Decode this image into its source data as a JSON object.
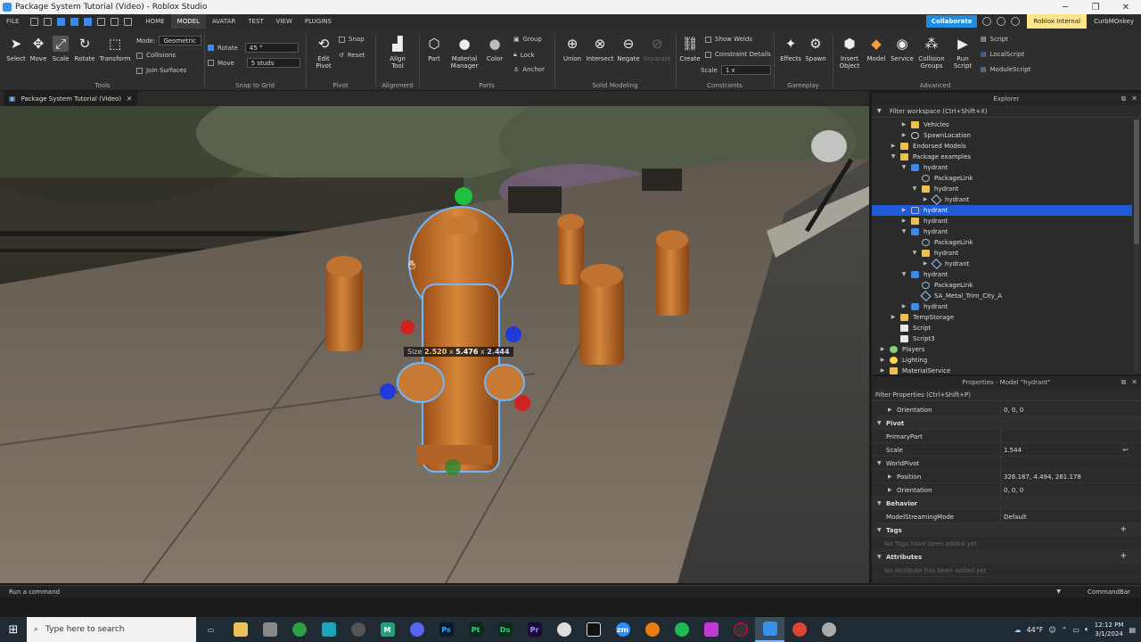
{
  "window": {
    "title": "Package System Tutorial (Video) - Roblox Studio"
  },
  "menu": {
    "items": [
      "FILE",
      "HOME",
      "MODEL",
      "AVATAR",
      "TEST",
      "VIEW",
      "PLUGINS"
    ],
    "active": "MODEL",
    "collaborate": "Collaborate",
    "badge": "Roblox Internal",
    "user": "CurbMOnkey"
  },
  "ribbon": {
    "tools": {
      "select": "Select",
      "move": "Move",
      "scale": "Scale",
      "rotate": "Rotate",
      "transform": "Transform",
      "group": "Tools"
    },
    "mode_label": "Mode:",
    "mode_value": "Geometric",
    "collisions": "Collisions",
    "join_surfaces": "Join Surfaces",
    "snap": {
      "rotate_label": "Rotate",
      "rotate_value": "45 °",
      "move_label": "Move",
      "move_value": "5 studs",
      "group": "Snap to Grid"
    },
    "pivot": {
      "edit": "Edit\nPivot",
      "snap": "Snap",
      "reset": "Reset",
      "group": "Pivot"
    },
    "alignment": {
      "align": "Align\nTool",
      "group": "Alignment"
    },
    "parts": {
      "part": "Part",
      "material": "Material\nManager",
      "color": "Color",
      "group_btn": "Group",
      "lock": "Lock",
      "anchor": "Anchor",
      "group": "Parts"
    },
    "solid": {
      "union": "Union",
      "intersect": "Intersect",
      "negate": "Negate",
      "separate": "Separate",
      "group": "Solid Modeling"
    },
    "constraints": {
      "create": "Create",
      "show_welds": "Show Welds",
      "details": "Constraint Details",
      "scale_label": "Scale",
      "scale_value": "1 x",
      "group": "Constraints"
    },
    "gameplay": {
      "effects": "Effects",
      "spawn": "Spawn",
      "group": "Gameplay"
    },
    "advanced": {
      "insert": "Insert\nObject",
      "model": "Model",
      "service": "Service",
      "collision": "Collision\nGroups",
      "run": "Run\nScript",
      "script": "Script",
      "localscript": "LocalScript",
      "modulescript": "ModuleScript",
      "group": "Advanced"
    }
  },
  "doc_tab": {
    "label": "Package System Tutorial (Video)"
  },
  "viewport": {
    "size_prefix": "Size",
    "size_x": "2.520",
    "size_y": "5.476",
    "size_z": "2.444"
  },
  "explorer": {
    "title": "Explorer",
    "filter": "Filter workspace (Ctrl+Shift+X)",
    "items": [
      {
        "label": "Vehicles",
        "icon": "folder-icon",
        "indent": 3,
        "arrow": "right"
      },
      {
        "label": "SpawnLocation",
        "icon": "spawn-icon",
        "indent": 3,
        "arrow": "right"
      },
      {
        "label": "Endorsed Models",
        "icon": "folder-icon",
        "indent": 2,
        "arrow": "right"
      },
      {
        "label": "Package examples",
        "icon": "folder-icon",
        "indent": 2,
        "arrow": "down"
      },
      {
        "label": "hydrant",
        "icon": "package-icon",
        "indent": 3,
        "arrow": "down"
      },
      {
        "label": "PackageLink",
        "icon": "link-icon",
        "indent": 4,
        "arrow": ""
      },
      {
        "label": "hydrant",
        "icon": "folder-icon",
        "indent": 4,
        "arrow": "down"
      },
      {
        "label": "hydrant",
        "icon": "union-icon",
        "indent": 5,
        "arrow": "right"
      },
      {
        "label": "hydrant",
        "icon": "model-icon",
        "indent": 3,
        "arrow": "right",
        "selected": true
      },
      {
        "label": "hydrant",
        "icon": "folder-icon",
        "indent": 3,
        "arrow": "right"
      },
      {
        "label": "hydrant",
        "icon": "package-icon",
        "indent": 3,
        "arrow": "down"
      },
      {
        "label": "PackageLink",
        "icon": "link-icon",
        "indent": 4,
        "arrow": ""
      },
      {
        "label": "hydrant",
        "icon": "folder-icon",
        "indent": 4,
        "arrow": "down"
      },
      {
        "label": "hydrant",
        "icon": "union-icon",
        "indent": 5,
        "arrow": "right"
      },
      {
        "label": "hydrant",
        "icon": "package-icon",
        "indent": 3,
        "arrow": "down"
      },
      {
        "label": "PackageLink",
        "icon": "link-icon",
        "indent": 4,
        "arrow": ""
      },
      {
        "label": "SA_Metal_Trim_City_A",
        "icon": "union-icon",
        "indent": 4,
        "arrow": ""
      },
      {
        "label": "hydrant",
        "icon": "package-icon",
        "indent": 3,
        "arrow": "right"
      },
      {
        "label": "TempStorage",
        "icon": "folder-icon",
        "indent": 2,
        "arrow": "right"
      },
      {
        "label": "Script",
        "icon": "script-icon",
        "indent": 2,
        "arrow": ""
      },
      {
        "label": "Script3",
        "icon": "script-icon",
        "indent": 2,
        "arrow": ""
      },
      {
        "label": "Players",
        "icon": "players-icon",
        "indent": 1,
        "arrow": "right"
      },
      {
        "label": "Lighting",
        "icon": "lighting-icon",
        "indent": 1,
        "arrow": "right"
      },
      {
        "label": "MaterialService",
        "icon": "folder-icon",
        "indent": 1,
        "arrow": "right"
      }
    ]
  },
  "properties": {
    "title": "Properties - Model \"hydrant\"",
    "filter": "Filter Properties (Ctrl+Shift+P)",
    "rows": [
      {
        "key": "Orientation",
        "value": "0, 0, 0",
        "type": "sub",
        "toggle": "right"
      },
      {
        "key": "Pivot",
        "value": "",
        "type": "cat",
        "toggle": "down"
      },
      {
        "key": "PrimaryPart",
        "value": "",
        "type": "ind"
      },
      {
        "key": "Scale",
        "value": "1.544",
        "type": "ind",
        "reset": true
      },
      {
        "key": "WorldPivot",
        "value": "",
        "type": "ind",
        "toggle": "down"
      },
      {
        "key": "Position",
        "value": "326.187, 4.494, 261.178",
        "type": "sub",
        "toggle": "right"
      },
      {
        "key": "Orientation",
        "value": "0, 0, 0",
        "type": "sub",
        "toggle": "right"
      },
      {
        "key": "Behavior",
        "value": "",
        "type": "cat",
        "toggle": "down"
      },
      {
        "key": "ModelStreamingMode",
        "value": "Default",
        "type": "ind"
      },
      {
        "key": "Tags",
        "value": "",
        "type": "cat",
        "toggle": "down",
        "plus": true
      },
      {
        "key": "No Tags have been added yet",
        "value": "",
        "type": "empty"
      },
      {
        "key": "Attributes",
        "value": "",
        "type": "cat",
        "toggle": "down",
        "plus": true
      },
      {
        "key": "No Attribute has been added yet",
        "value": "",
        "type": "empty"
      }
    ]
  },
  "command_bar": {
    "placeholder": "Run a command",
    "label": "CommandBar"
  },
  "taskbar": {
    "search": "Type here to search",
    "temperature": "44°F",
    "time": "12:12 PM",
    "date": "3/1/2024"
  }
}
